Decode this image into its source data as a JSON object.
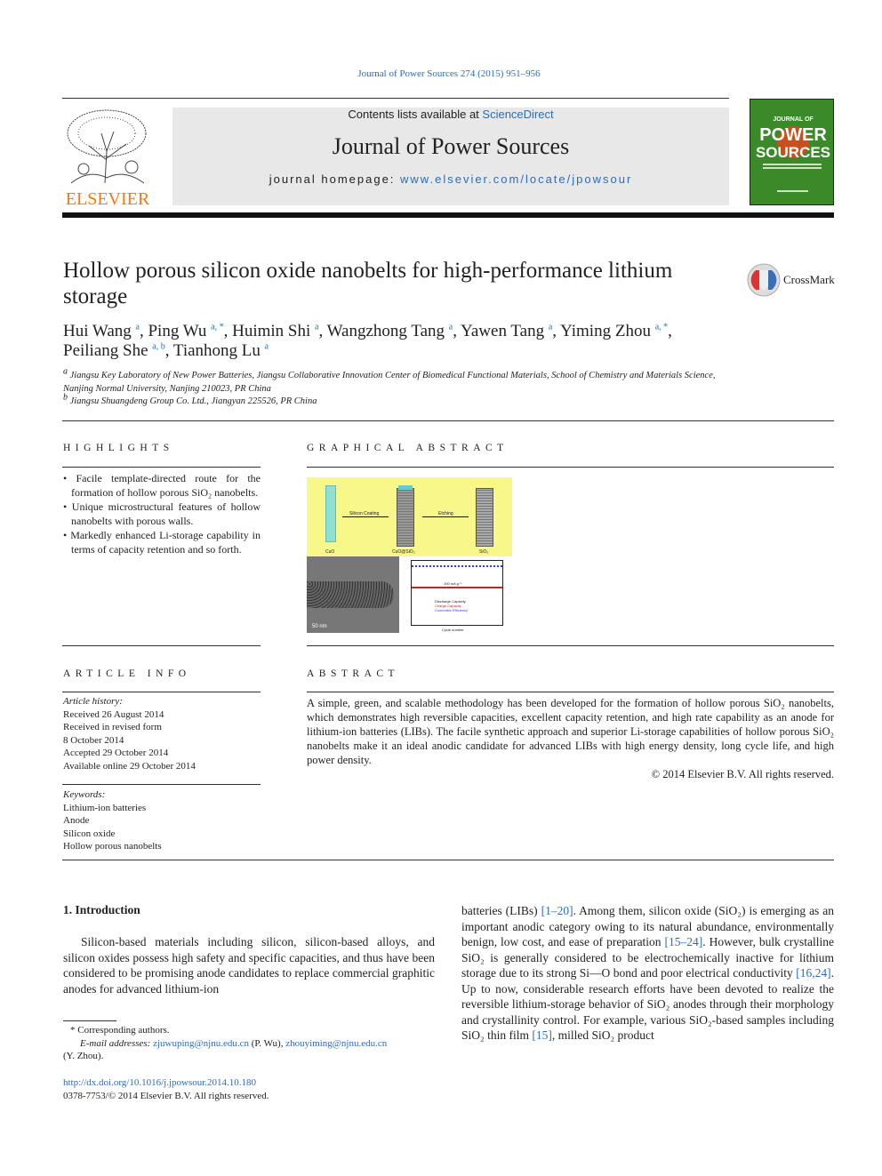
{
  "header": {
    "citation": "Journal of Power Sources 274 (2015) 951–956",
    "contents_prefix": "Contents lists available at ",
    "contents_link": "ScienceDirect",
    "journal_title": "Journal of Power Sources",
    "homepage_prefix": "journal homepage: ",
    "homepage_link": "www.elsevier.com/locate/jpowsour",
    "publisher_logo": "ELSEVIER",
    "cover_text": "JOURNAL OF POWER SOURCES"
  },
  "article": {
    "title": "Hollow porous silicon oxide nanobelts for high-performance lithium storage",
    "crossmark": "CrossMark",
    "authors": [
      {
        "name": "Hui Wang",
        "sup": "a"
      },
      {
        "name": "Ping Wu",
        "sup": "a, *"
      },
      {
        "name": "Huimin Shi",
        "sup": "a"
      },
      {
        "name": "Wangzhong Tang",
        "sup": "a"
      },
      {
        "name": "Yawen Tang",
        "sup": "a"
      },
      {
        "name": "Yiming Zhou",
        "sup": "a, *"
      },
      {
        "name": "Peiliang She",
        "sup": "a, b"
      },
      {
        "name": "Tianhong Lu",
        "sup": "a"
      }
    ],
    "affiliations": [
      {
        "sup": "a",
        "text": "Jiangsu Key Laboratory of New Power Batteries, Jiangsu Collaborative Innovation Center of Biomedical Functional Materials, School of Chemistry and Materials Science, Nanjing Normal University, Nanjing 210023, PR China"
      },
      {
        "sup": "b",
        "text": "Jiangsu Shuangdeng Group Co. Ltd., Jiangyan 225526, PR China"
      }
    ]
  },
  "highlights": {
    "heading": "HIGHLIGHTS",
    "items": [
      "Facile template-directed route for the formation of hollow porous SiO₂ nanobelts.",
      "Unique microstructural features of hollow nanobelts with porous walls.",
      "Markedly enhanced Li-storage capability in terms of capacity retention and so forth."
    ]
  },
  "graphical_abstract": {
    "heading": "GRAPHICAL ABSTRACT",
    "labels": {
      "step1": "Silicon Coating",
      "step2": "Etching",
      "cuo": "CuO",
      "cuo_sio2": "CuO@SiO₂",
      "sio2": "SiO₂",
      "scale": "50 nm",
      "current": "100 mA g⁻¹",
      "xlabel": "Cycle number",
      "ylabel": "Capacity (mAh g⁻¹)",
      "y2label": "Coulombic Efficiency (%)"
    },
    "legend": [
      "Discharge Capacity",
      "Charge Capacity",
      "Coulombic Efficiency"
    ]
  },
  "article_info": {
    "heading": "ARTICLE INFO",
    "history_label": "Article history:",
    "history": [
      "Received 26 August 2014",
      "Received in revised form",
      "8 October 2014",
      "Accepted 29 October 2014",
      "Available online 29 October 2014"
    ],
    "keywords_label": "Keywords:",
    "keywords": [
      "Lithium-ion batteries",
      "Anode",
      "Silicon oxide",
      "Hollow porous nanobelts"
    ]
  },
  "abstract": {
    "heading": "ABSTRACT",
    "text": "A simple, green, and scalable methodology has been developed for the formation of hollow porous SiO₂ nanobelts, which demonstrates high reversible capacities, excellent capacity retention, and high rate capability as an anode for lithium-ion batteries (LIBs). The facile synthetic approach and superior Li-storage capabilities of hollow porous SiO₂ nanobelts make it an ideal anodic candidate for advanced LIBs with high energy density, long cycle life, and high power density.",
    "copyright": "© 2014 Elsevier B.V. All rights reserved."
  },
  "body": {
    "section_title": "1.  Introduction",
    "left_para": "Silicon-based materials including silicon, silicon-based alloys, and silicon oxides possess high safety and specific capacities, and thus have been considered to be promising anode candidates to replace commercial graphitic anodes for advanced lithium-ion",
    "right_para": [
      {
        "t": "batteries (LIBs) "
      },
      {
        "l": "[1–20]"
      },
      {
        "t": ". Among them, silicon oxide (SiO₂) is emerging as an important anodic category owing to its natural abundance, environmentally benign, low cost, and ease of preparation "
      },
      {
        "l": "[15–24]"
      },
      {
        "t": ". However, bulk crystalline SiO₂ is generally considered to be electrochemically inactive for lithium storage due to its strong Si—O bond and poor electrical conductivity "
      },
      {
        "l": "[16,24]"
      },
      {
        "t": ". Up to now, considerable research efforts have been devoted to realize the reversible lithium-storage behavior of SiO₂ anodes through their morphology and crystallinity control. For example, various SiO₂-based samples including SiO₂ thin film "
      },
      {
        "l": "[15]"
      },
      {
        "t": ", milled SiO₂ product"
      }
    ]
  },
  "footnotes": {
    "corresponding": "Corresponding authors.",
    "email_label": "E-mail addresses:",
    "email1": "zjuwuping@njnu.edu.cn",
    "email1_who": " (P. Wu), ",
    "email2": "zhouyiming@njnu.edu.cn",
    "email2_who": "(Y. Zhou).",
    "doi": "http://dx.doi.org/10.1016/j.jpowsour.2014.10.180",
    "issn": "0378-7753/© 2014 Elsevier B.V. All rights reserved."
  },
  "colors": {
    "link": "#2a6ebb",
    "banner": "#e8e8e8",
    "cover": "#3a8a2a",
    "ga_bg": "#f7f78a",
    "elsevier": "#f07a16"
  }
}
